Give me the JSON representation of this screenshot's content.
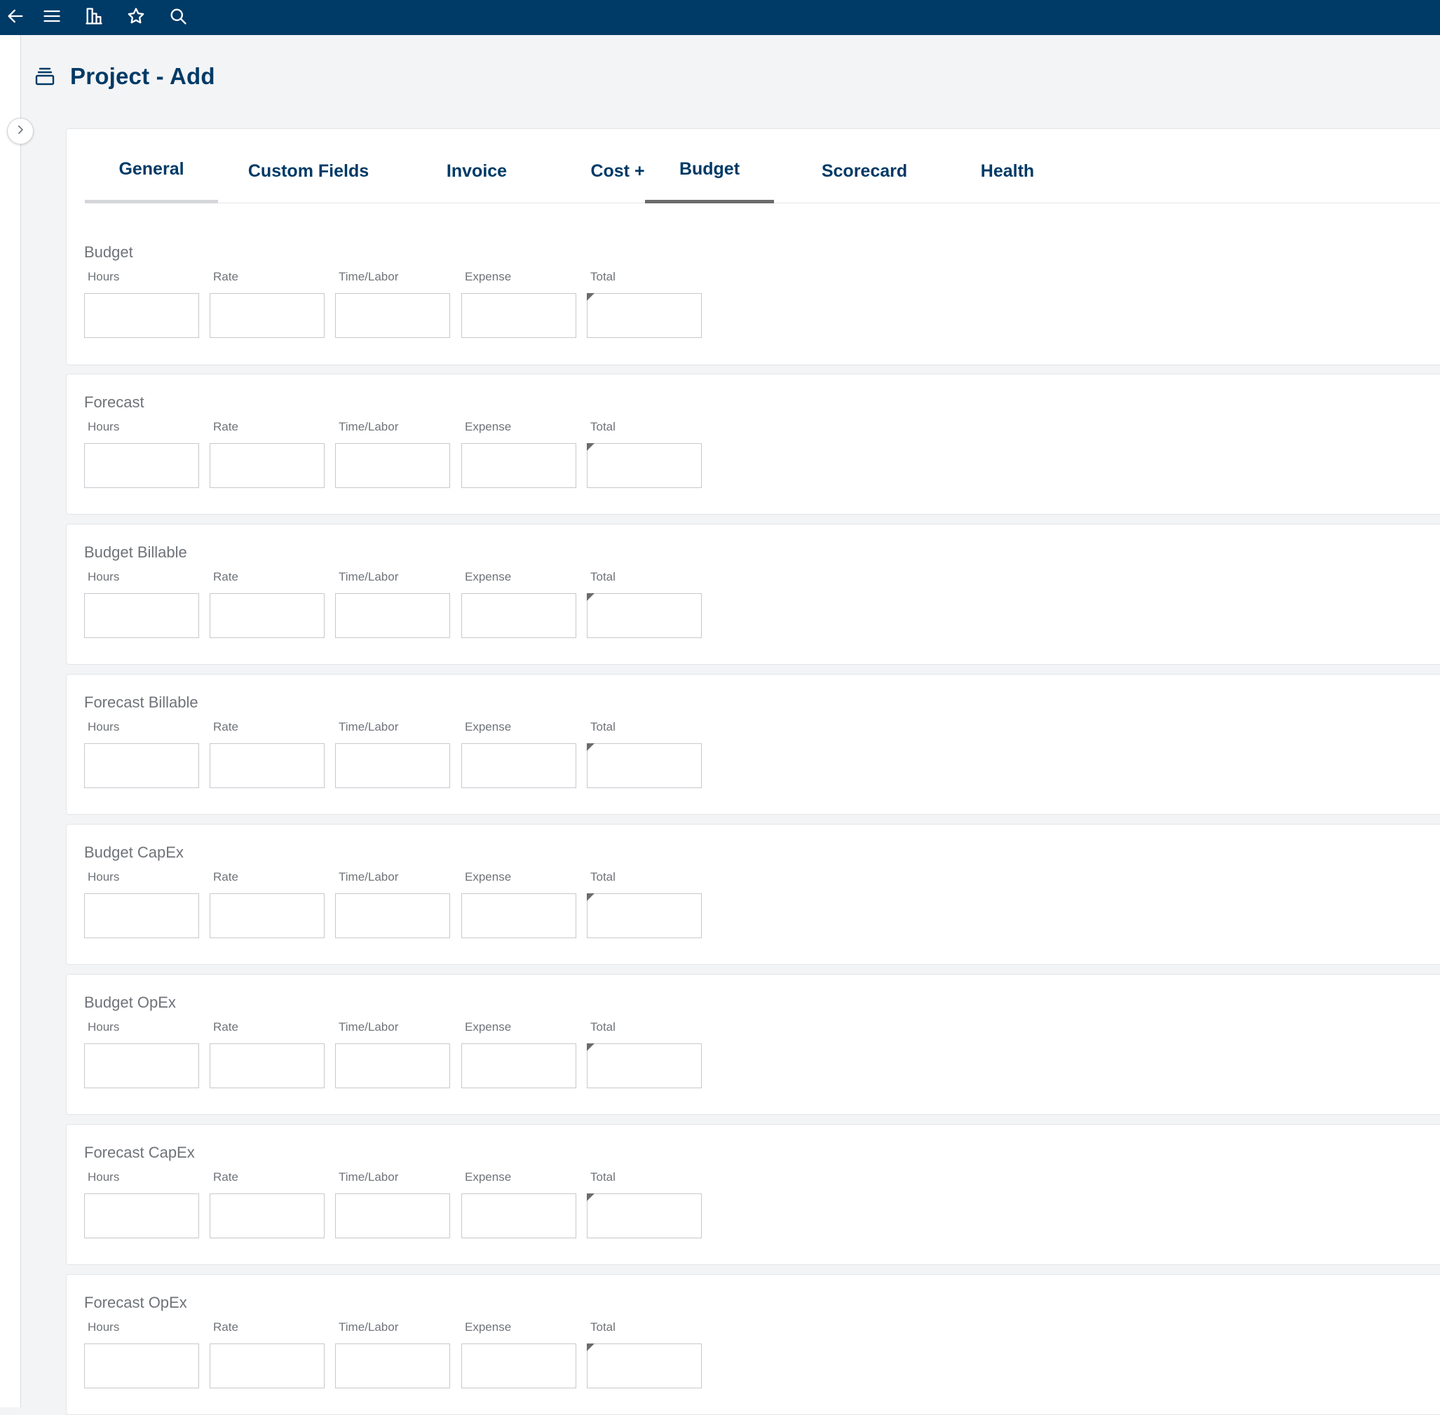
{
  "topbar": {
    "icons": [
      "back-arrow-icon",
      "hamburger-menu-icon",
      "org-chart-icon",
      "star-icon",
      "search-icon"
    ]
  },
  "header": {
    "icon": "stack-icon",
    "title": "Project - Add"
  },
  "tabs": [
    {
      "label": "General",
      "state": "visited"
    },
    {
      "label": "Custom Fields",
      "state": "normal"
    },
    {
      "label": "Invoice",
      "state": "normal"
    },
    {
      "label": "Cost +",
      "state": "normal"
    },
    {
      "label": "Budget",
      "state": "active"
    },
    {
      "label": "Scorecard",
      "state": "normal"
    },
    {
      "label": "Health",
      "state": "normal"
    }
  ],
  "field_labels": {
    "hours": "Hours",
    "rate": "Rate",
    "time_labor": "Time/Labor",
    "expense": "Expense",
    "total": "Total"
  },
  "sections": [
    {
      "title": "Budget"
    },
    {
      "title": "Forecast"
    },
    {
      "title": "Budget Billable"
    },
    {
      "title": "Forecast Billable"
    },
    {
      "title": "Budget CapEx"
    },
    {
      "title": "Budget OpEx"
    },
    {
      "title": "Forecast CapEx"
    },
    {
      "title": "Forecast OpEx"
    }
  ],
  "colors": {
    "topbar": "#003a66",
    "title_text": "#003a66",
    "active_tab_underline": "#6b6b6b"
  }
}
